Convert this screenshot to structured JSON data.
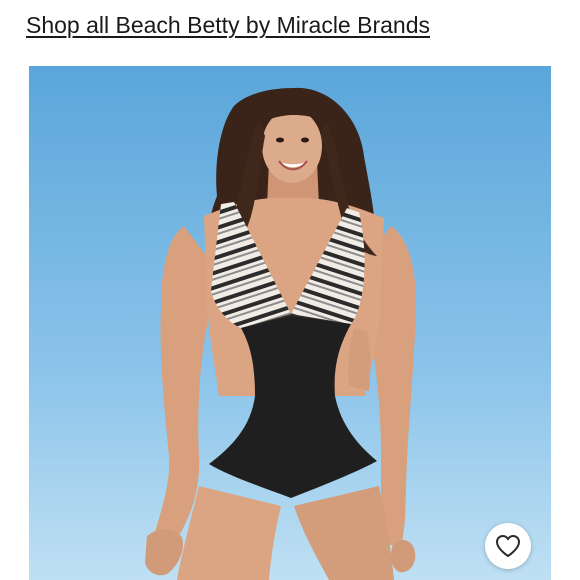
{
  "shop_link": {
    "label": "Shop all Beach Betty by Miracle Brands"
  },
  "product_image": {
    "alt": "Woman wearing a striped top black bottom one-piece swimsuit",
    "background_top": "#5aa6da",
    "background_bottom": "#bfe0f3"
  },
  "like_button": {
    "icon": "heart-outline-icon"
  }
}
